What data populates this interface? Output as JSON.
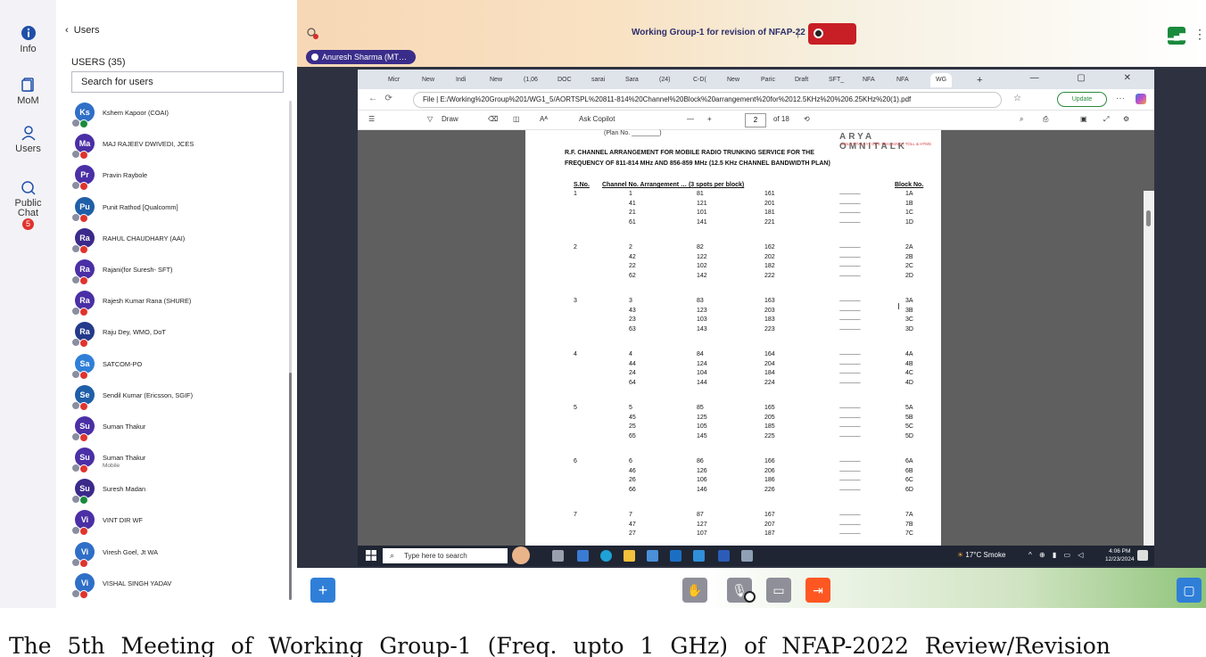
{
  "rail": {
    "items": [
      {
        "label": "Info",
        "icon": "info-icon"
      },
      {
        "label": "MoM",
        "icon": "document-icon"
      },
      {
        "label": "Users",
        "icon": "user-icon"
      },
      {
        "label": "Public Chat",
        "icon": "chat-icon",
        "badge": "5"
      }
    ]
  },
  "users_panel": {
    "back_label": "Users",
    "count_label": "USERS (35)",
    "search_placeholder": "Search for users",
    "users": [
      {
        "initials": "Ks",
        "name": "Kshem Kapoor (COAI)",
        "color": "#2f6fc7",
        "mic": "green"
      },
      {
        "initials": "Ma",
        "name": "MAJ RAJEEV DWIVEDI, JCES",
        "color": "#4a2fa6",
        "mic": "red"
      },
      {
        "initials": "Pr",
        "name": "Pravin Raybole",
        "color": "#4a2fa6",
        "mic": "red"
      },
      {
        "initials": "Pu",
        "name": "Punit Rathod [Qualcomm]",
        "color": "#1f5fa8",
        "mic": "red"
      },
      {
        "initials": "Ra",
        "name": "RAHUL CHAUDHARY (AAI)",
        "color": "#3b2a8a",
        "mic": "red"
      },
      {
        "initials": "Ra",
        "name": "Rajani(for Suresh- SFT)",
        "color": "#4a2fa6",
        "mic": "red"
      },
      {
        "initials": "Ra",
        "name": "Rajesh Kumar Rana (SHURE)",
        "color": "#4a2fa6",
        "mic": "red"
      },
      {
        "initials": "Ra",
        "name": "Raju Dey, WMO, DoT",
        "color": "#243a8a",
        "mic": "red"
      },
      {
        "initials": "Sa",
        "name": "SATCOM-PO",
        "color": "#2f7fd8",
        "mic": "red"
      },
      {
        "initials": "Se",
        "name": "Sendil Kumar (Ericsson, SGIF)",
        "color": "#1f5fa8",
        "mic": "red"
      },
      {
        "initials": "Su",
        "name": "Suman Thakur",
        "color": "#4a2fa6",
        "mic": "red"
      },
      {
        "initials": "Su",
        "name": "Suman Thakur",
        "sub": "Mobile",
        "color": "#4a2fa6",
        "mic": "red"
      },
      {
        "initials": "Su",
        "name": "Suresh Madan",
        "color": "#3b2a8a",
        "mic": "green"
      },
      {
        "initials": "Vi",
        "name": "VINT DIR WF",
        "color": "#4a2fa6",
        "mic": "red"
      },
      {
        "initials": "Vi",
        "name": "Viresh Goel, Jt WA",
        "color": "#2f6fc7",
        "mic": "red"
      },
      {
        "initials": "Vi",
        "name": "VISHAL SINGH YADAV",
        "color": "#2f6fc7",
        "mic": "red"
      }
    ]
  },
  "stage": {
    "meeting_title": "Working Group-1 for revision of NFAP-22",
    "separator": "|",
    "presenter": "Anuresh Sharma (MT…",
    "more_glyph": "⋮",
    "signal_glyph": "▂▄▆"
  },
  "browser": {
    "tabs": [
      "Micr",
      "New",
      "Indi",
      "New",
      "(1,06",
      "DOC",
      "sarai",
      "Sara",
      "(24)",
      "C-D(",
      "New",
      "Paric",
      "Draft",
      "SFT_",
      "NFA",
      "NFA",
      "WG"
    ],
    "window_controls": "—  ▢  ✕",
    "url": "File  |  E:/Working%20Group%201/WG1_5/AORTSPL%20811-814%20Channel%20Block%20arrangement%20for%2012.5KHz%20%206.25KHz%20(1).pdf",
    "update_label": "Update",
    "pdf_toolbar": {
      "draw_label": "Draw",
      "ask_label": "Ask Copilot",
      "page_current": "2",
      "page_total": "of 18",
      "zoom_minus": "—",
      "zoom_plus": "+"
    }
  },
  "pdf": {
    "plan_label": "(Plan No. ________)",
    "logo": "ARYA OMNITALK",
    "logo_sub": "WALKY TALKY | GPS TRACKING | TOLL & HTMS",
    "heading1": "R.F. CHANNEL ARRANGEMENT FOR MOBILE RADIO TRUNKING SERVICE FOR THE",
    "heading2": "FREQUENCY OF 811-814 MHz AND 856-859 MHz (12.5 KHz CHANNEL BANDWIDTH PLAN)",
    "col_sno": "S.No.",
    "col_arr": "Channel No. Arrangement … (3 spots per block)",
    "col_block": "Block No.",
    "dashes": "--------------------",
    "groups": [
      {
        "sno": "1",
        "rows": [
          [
            "1",
            "81",
            "161",
            "1A"
          ],
          [
            "41",
            "121",
            "201",
            "1B"
          ],
          [
            "21",
            "101",
            "181",
            "1C"
          ],
          [
            "61",
            "141",
            "221",
            "1D"
          ]
        ]
      },
      {
        "sno": "2",
        "rows": [
          [
            "2",
            "82",
            "162",
            "2A"
          ],
          [
            "42",
            "122",
            "202",
            "2B"
          ],
          [
            "22",
            "102",
            "182",
            "2C"
          ],
          [
            "62",
            "142",
            "222",
            "2D"
          ]
        ]
      },
      {
        "sno": "3",
        "rows": [
          [
            "3",
            "83",
            "163",
            "3A"
          ],
          [
            "43",
            "123",
            "203",
            "3B"
          ],
          [
            "23",
            "103",
            "183",
            "3C"
          ],
          [
            "63",
            "143",
            "223",
            "3D"
          ]
        ]
      },
      {
        "sno": "4",
        "rows": [
          [
            "4",
            "84",
            "164",
            "4A"
          ],
          [
            "44",
            "124",
            "204",
            "4B"
          ],
          [
            "24",
            "104",
            "184",
            "4C"
          ],
          [
            "64",
            "144",
            "224",
            "4D"
          ]
        ]
      },
      {
        "sno": "5",
        "rows": [
          [
            "5",
            "85",
            "165",
            "5A"
          ],
          [
            "45",
            "125",
            "205",
            "5B"
          ],
          [
            "25",
            "105",
            "185",
            "5C"
          ],
          [
            "65",
            "145",
            "225",
            "5D"
          ]
        ]
      },
      {
        "sno": "6",
        "rows": [
          [
            "6",
            "86",
            "166",
            "6A"
          ],
          [
            "46",
            "126",
            "206",
            "6B"
          ],
          [
            "26",
            "106",
            "186",
            "6C"
          ],
          [
            "66",
            "146",
            "226",
            "6D"
          ]
        ]
      },
      {
        "sno": "7",
        "rows": [
          [
            "7",
            "87",
            "167",
            "7A"
          ],
          [
            "47",
            "127",
            "207",
            "7B"
          ],
          [
            "27",
            "107",
            "187",
            "7C"
          ]
        ]
      }
    ]
  },
  "taskbar": {
    "search_placeholder": "Type here to search",
    "weather": "17°C  Smoke",
    "time": "4:06 PM",
    "date": "12/23/2024"
  },
  "caption": "The 5th Meeting of Working Group-1 (Freq. upto 1 GHz) of NFAP-2022 Review/Revision"
}
